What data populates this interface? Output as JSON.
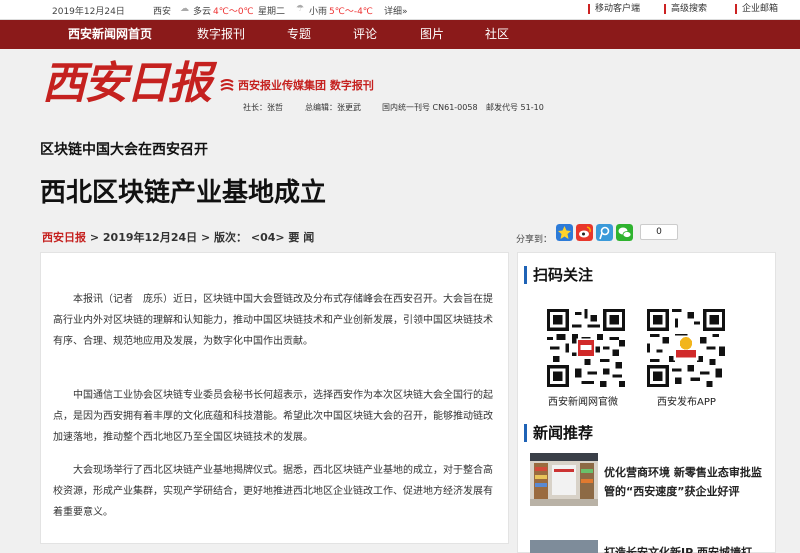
{
  "topbar": {
    "date": "2019年12月24日",
    "city": "西安",
    "weather1": "多云",
    "temp1": "4℃～0℃",
    "weekday": "星期二",
    "weather2": "小雨",
    "temp2": "5℃～-4℃",
    "detail": "详细»",
    "links": [
      "移动客户端",
      "高级搜索",
      "企业邮箱"
    ]
  },
  "nav": {
    "items": [
      "西安新闻网首页",
      "数字报刊",
      "专题",
      "评论",
      "图片",
      "社区"
    ]
  },
  "header": {
    "logo_text": "西安日报",
    "group_name": "西安报业传媒集团 数字报刊",
    "president": "社长：张哲",
    "editor": "总编辑：张更武",
    "cn_code": "国内统一刊号 CN61-0058",
    "postal_code": "邮发代号 51-10"
  },
  "article": {
    "subtitle": "区块链中国大会在西安召开",
    "title": "西北区块链产业基地成立",
    "source": "西安日报",
    "date": "2019年12月24日",
    "edition_label": "版次：",
    "edition": "<04> 要 闻",
    "share_label": "分享到：",
    "share_count": "0",
    "paragraphs": [
      "本报讯（记者　庞乐）近日，区块链中国大会暨链改及分布式存储峰会在西安召开。大会旨在提高行业内外对区块链的理解和认知能力，推动中国区块链技术和产业创新发展，引领中国区块链技术有序、合理、规范地应用及发展，为数字化中国作出贡献。",
      "中国通信工业协会区块链专业委员会秘书长何超表示，选择西安作为本次区块链大会全国行的起点，是因为西安拥有着丰厚的文化底蕴和科技潜能。希望此次中国区块链大会的召开，能够推动链改加速落地，推动整个西北地区乃至全国区块链技术的发展。",
      "大会现场举行了西北区块链产业基地揭牌仪式。据悉，西北区块链产业基地的成立，对于整合高校资源，形成产业集群，实现产学研结合，更好地推进西北地区企业链改工作、促进地方经济发展有着重要意义。"
    ]
  },
  "sidebar": {
    "qr_title": "扫码关注",
    "qr1_label": "西安新闻网官微",
    "qr2_label": "西安发布APP",
    "news_title": "新闻推荐",
    "news1": "优化营商环境 新零售业态审批监管的“西安速度”获企业好评",
    "news2": "打造长安文化新IP 西安城墙打"
  },
  "colors": {
    "nav_bg": "#8b1a1a",
    "brand_red": "#c5211f",
    "section_accent": "#1f63b6"
  }
}
